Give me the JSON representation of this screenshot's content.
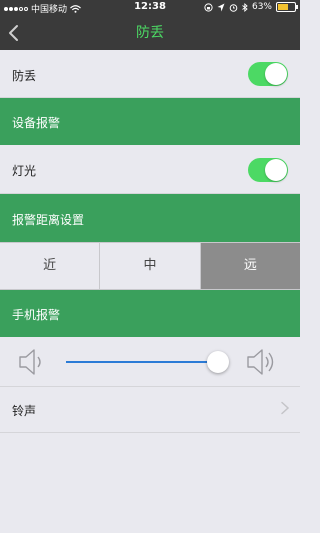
{
  "status_bar": {
    "carrier": "中国移动",
    "time": "12:38",
    "battery": "63%",
    "battery_level": 0.63
  },
  "nav": {
    "title": "防丢",
    "back_icon": "chevron-left-icon"
  },
  "rows": {
    "anti_loss": {
      "label": "防丢",
      "enabled": true
    },
    "light": {
      "label": "灯光",
      "enabled": true
    },
    "ringtone": {
      "label": "铃声"
    }
  },
  "sections": {
    "device_alarm": "设备报警",
    "distance": "报警距离设置",
    "phone_alarm": "手机报警"
  },
  "distance_options": [
    "近",
    "中",
    "远"
  ],
  "distance_selected": "远",
  "volume": {
    "level": 0.95
  },
  "colors": {
    "accent_green": "#3aa05c",
    "toggle_green": "#4cd964",
    "slider_blue": "#2b7bd6",
    "nav_bg": "#3a3a3a",
    "selected_segment": "#8c8c8c"
  }
}
